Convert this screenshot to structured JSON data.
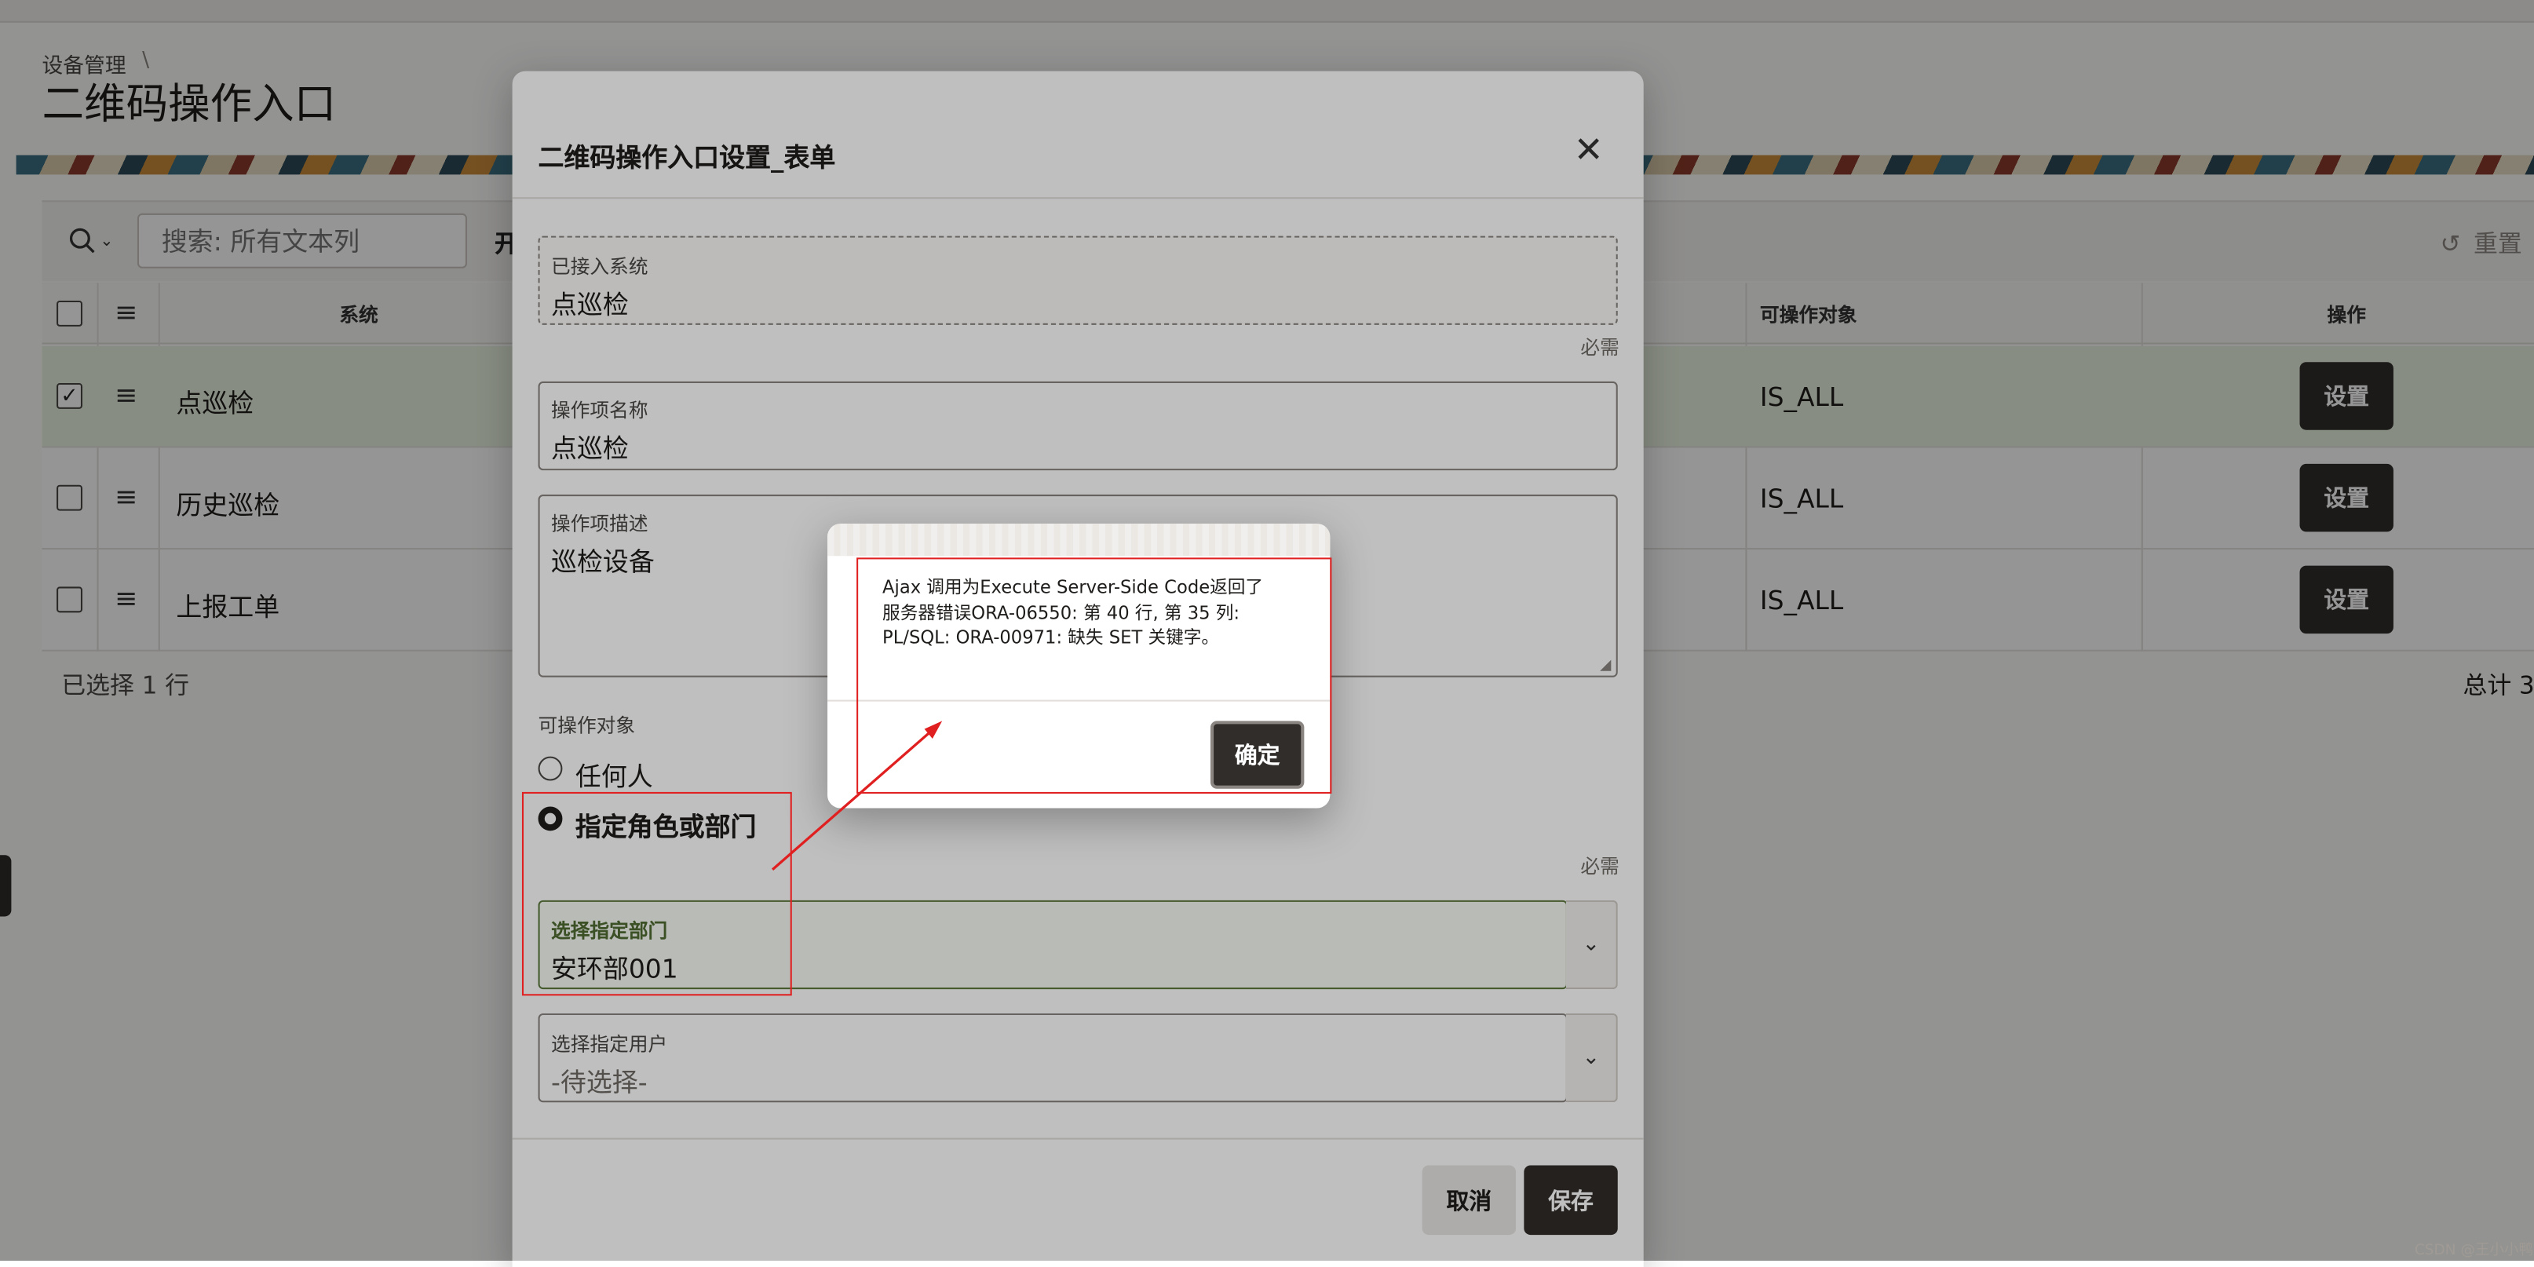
{
  "breadcrumb": {
    "parent": "设备管理",
    "separator": "\\"
  },
  "page_title": "二维码操作入口",
  "toolbar": {
    "search_placeholder": "搜索: 所有文本列",
    "go_label": "开",
    "reset_label": "重置"
  },
  "grid": {
    "headers": {
      "system": "系统",
      "targets": "可操作对象",
      "actions": "操作"
    },
    "rows": [
      {
        "system": "点巡检",
        "targets": "IS_ALL",
        "action": "设置",
        "selected": true
      },
      {
        "system": "历史巡检",
        "targets": "IS_ALL",
        "action": "设置",
        "selected": false
      },
      {
        "system": "上报工单",
        "targets": "IS_ALL",
        "action": "设置",
        "selected": false
      }
    ],
    "footer_selected": "已选择 1 行",
    "footer_total": "总计 3"
  },
  "dialog": {
    "title": "二维码操作入口设置_表单",
    "fields": {
      "system": {
        "label": "已接入系统",
        "value": "点巡检",
        "required": "必需"
      },
      "name": {
        "label": "操作项名称",
        "value": "点巡检"
      },
      "desc": {
        "label": "操作项描述",
        "value": "巡检设备"
      },
      "targets": {
        "label": "可操作对象",
        "options": [
          "任何人",
          "指定角色或部门"
        ],
        "selected": "指定角色或部门",
        "required": "必需"
      },
      "department": {
        "label": "选择指定部门",
        "value": "安环部001"
      },
      "user": {
        "label": "选择指定用户",
        "placeholder": "-待选择-"
      }
    },
    "buttons": {
      "cancel": "取消",
      "save": "保存"
    }
  },
  "alert": {
    "message_lines": [
      "Ajax 调用为Execute Server-Side Code返回了",
      "服务器错误ORA-06550: 第 40 行, 第 35 列:",
      "PL/SQL: ORA-00971: 缺失 SET 关键字。"
    ],
    "ok_label": "确定"
  },
  "watermark": "CSDN @王小小鸭",
  "colors": {
    "accent_dark": "#312d2a",
    "selected_row": "#e9f3e0",
    "annotation_red": "#e02020",
    "active_field": "#5c7a3e"
  },
  "icons": [
    "search-icon",
    "chevron-down-icon",
    "reset-icon",
    "close-icon",
    "checkbox-icon",
    "row-menu-icon",
    "radio-icon"
  ]
}
